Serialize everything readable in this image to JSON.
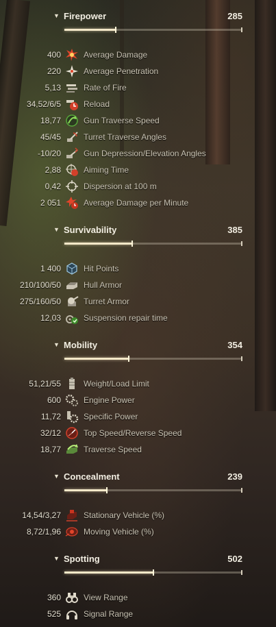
{
  "sections": [
    {
      "title": "Firepower",
      "score": "285",
      "level": 0.29,
      "rows": [
        {
          "value": "400",
          "label": "Average Damage",
          "icon": "damage-burst-icon"
        },
        {
          "value": "220",
          "label": "Average Penetration",
          "icon": "penetration-burst-icon"
        },
        {
          "value": "5,13",
          "label": "Rate of Fire",
          "icon": "shells-icon"
        },
        {
          "value": "34,52/6/5",
          "label": "Reload",
          "icon": "reload-clock-icon"
        },
        {
          "value": "18,77",
          "label": "Gun Traverse Speed",
          "icon": "gun-traverse-arrow-icon"
        },
        {
          "value": "45/45",
          "label": "Turret Traverse Angles",
          "icon": "turret-angle-icon"
        },
        {
          "value": "-10/20",
          "label": "Gun Depression/Elevation Angles",
          "icon": "gun-elevation-icon"
        },
        {
          "value": "2,88",
          "label": "Aiming Time",
          "icon": "aiming-clock-icon"
        },
        {
          "value": "0,42",
          "label": "Dispersion at 100 m",
          "icon": "crosshair-icon"
        },
        {
          "value": "2 051",
          "label": "Average Damage per Minute",
          "icon": "damage-per-minute-icon"
        }
      ]
    },
    {
      "title": "Survivability",
      "score": "385",
      "level": 0.38,
      "rows": [
        {
          "value": "1 400",
          "label": "Hit Points",
          "icon": "hit-points-cube-icon"
        },
        {
          "value": "210/100/50",
          "label": "Hull Armor",
          "icon": "hull-armor-icon"
        },
        {
          "value": "275/160/50",
          "label": "Turret Armor",
          "icon": "turret-armor-icon"
        },
        {
          "value": "12,03",
          "label": "Suspension repair time",
          "icon": "suspension-repair-icon"
        }
      ]
    },
    {
      "title": "Mobility",
      "score": "354",
      "level": 0.36,
      "rows": [
        {
          "value": "51,21/55",
          "label": "Weight/Load Limit",
          "icon": "weight-icon"
        },
        {
          "value": "600",
          "label": "Engine Power",
          "icon": "engine-gears-icon"
        },
        {
          "value": "11,72",
          "label": "Specific Power",
          "icon": "specific-power-icon"
        },
        {
          "value": "32/12",
          "label": "Top Speed/Reverse Speed",
          "icon": "speed-gauge-icon"
        },
        {
          "value": "18,77",
          "label": "Traverse Speed",
          "icon": "traverse-arrow-icon"
        }
      ]
    },
    {
      "title": "Concealment",
      "score": "239",
      "level": 0.24,
      "rows": [
        {
          "value": "14,54/3,27",
          "label": "Stationary Vehicle (%)",
          "icon": "stationary-camo-icon"
        },
        {
          "value": "8,72/1,96",
          "label": "Moving Vehicle (%)",
          "icon": "moving-camo-icon"
        }
      ]
    },
    {
      "title": "Spotting",
      "score": "502",
      "level": 0.5,
      "rows": [
        {
          "value": "360",
          "label": "View Range",
          "icon": "binoculars-icon"
        },
        {
          "value": "525",
          "label": "Signal Range",
          "icon": "headphones-icon"
        }
      ]
    }
  ],
  "colors": {
    "accent": "#f3e8c8",
    "text": "#c9c3b3",
    "value": "#e4dfd0",
    "icon_red": "#d2402a",
    "icon_green": "#57a83a"
  }
}
